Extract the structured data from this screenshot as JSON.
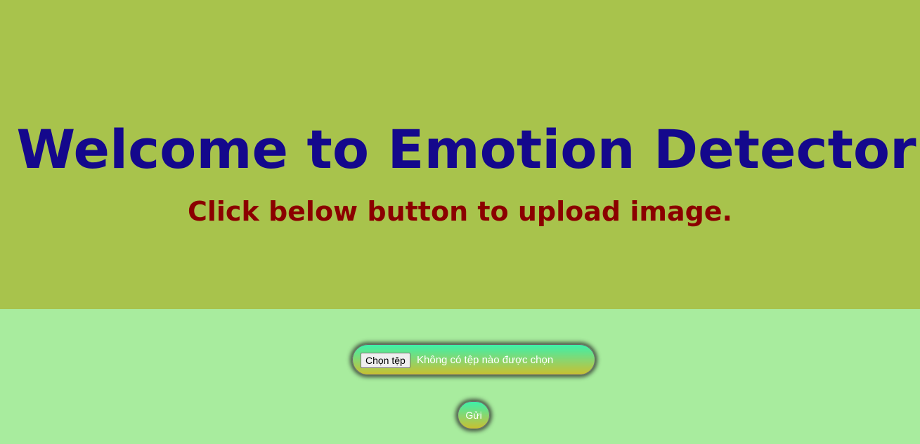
{
  "hero": {
    "title": "Welcome to Emotion Detector",
    "subtitle": "Click below button to upload image."
  },
  "upload": {
    "choose_file_label": "Chọn tệp",
    "no_file_text": "Không có tệp nào được chọn",
    "submit_label": "Gửi"
  },
  "colors": {
    "hero_background": "#a8c34c",
    "upload_background": "#a8ec9e",
    "title_color": "#14088c",
    "subtitle_color": "#8b0000"
  }
}
